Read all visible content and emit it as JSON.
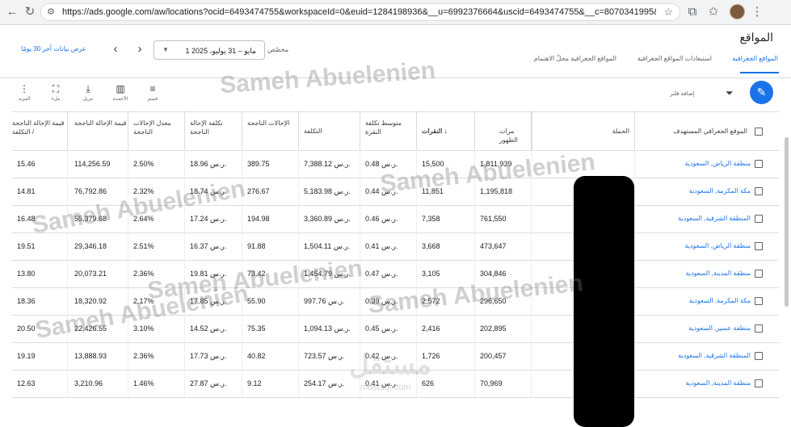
{
  "browser": {
    "url": "https://ads.google.com/aw/locations?ocid=6493474755&workspaceId=0&euid=1284198936&__u=6992376664&uscid=6493474755&__c=8070341995&authuser=..."
  },
  "page": {
    "title": "المواقع",
    "tabs": [
      "المواقع الجغرافية",
      "استبعادات المواقع الجغرافية",
      "المواقع الجغرافية محلّ الاهتمام"
    ],
    "date_range": "1 مايو – 31 يوليو، 2025",
    "custom_label": "مخصّص",
    "show_last_30": "عرض بيانات آخر 30 يومًا"
  },
  "toolbar": {
    "add_filter": "إضافة فلتر",
    "tools": [
      {
        "icon": "segment-icon",
        "glyph": "≡",
        "label": "قسم"
      },
      {
        "icon": "columns-icon",
        "glyph": "▥",
        "label": "الأعمدة"
      },
      {
        "icon": "download-icon",
        "glyph": "⤓",
        "label": "تنزيل"
      },
      {
        "icon": "expand-icon",
        "glyph": "⛶",
        "label": "ملء"
      },
      {
        "icon": "more-icon",
        "glyph": "⋮",
        "label": "المزيد"
      }
    ]
  },
  "table": {
    "headers": {
      "location": "الموقع الجغرافي المستهدف",
      "campaign": "الحملة",
      "impressions": "مرات الظهور",
      "clicks": "النقرات",
      "avg_cpc": "متوسط تكلفة النقرة",
      "cost": "التكلفة",
      "conversions": "الإحالات الناجحة",
      "cost_per_conv": "تكلفة الإحالة الناجحة",
      "conv_rate": "معدل الإحالات الناجحة",
      "conv_value": "قيمة الإحالة الناجحة",
      "value_per_cost": "قيمة الإحالة الناجحة / التكلفة"
    },
    "rows": [
      {
        "location": "منطقة الرياض, السعودية",
        "impressions": "1,811,939",
        "clicks": "15,500",
        "avg_cpc": "0.48 ر.س.",
        "cost": "7,388.12 ر.س.",
        "conversions": "389.75",
        "cost_per_conv": "18.96 ر.س.",
        "conv_rate": "2.50%",
        "conv_value": "114,256.59",
        "value_per_cost": "15.46"
      },
      {
        "location": "مكة المكرمة, السعودية",
        "impressions": "1,195,818",
        "clicks": "11,851",
        "avg_cpc": "0.44 ر.س.",
        "cost": "5,183.98 ر.س.",
        "conversions": "276.67",
        "cost_per_conv": "18.74 ر.س.",
        "conv_rate": "2.32%",
        "conv_value": "76,792.86",
        "value_per_cost": "14.81"
      },
      {
        "location": "المنطقة الشرقية, السعودية",
        "impressions": "761,550",
        "clicks": "7,358",
        "avg_cpc": "0.46 ر.س.",
        "cost": "3,360.89 ر.س.",
        "conversions": "194.98",
        "cost_per_conv": "17.24 ر.س.",
        "conv_rate": "2.64%",
        "conv_value": "55,379.68",
        "value_per_cost": "16.48"
      },
      {
        "location": "منطقة الرياض, السعودية",
        "impressions": "473,647",
        "clicks": "3,668",
        "avg_cpc": "0.41 ر.س.",
        "cost": "1,504.11 ر.س.",
        "conversions": "91.88",
        "cost_per_conv": "16.37 ر.س.",
        "conv_rate": "2.51%",
        "conv_value": "29,346.18",
        "value_per_cost": "19.51"
      },
      {
        "location": "منطقة المدينة, السعودية",
        "impressions": "304,846",
        "clicks": "3,105",
        "avg_cpc": "0.47 ر.س.",
        "cost": "1,454.79 ر.س.",
        "conversions": "73.42",
        "cost_per_conv": "19.81 ر.س.",
        "conv_rate": "2.36%",
        "conv_value": "20,073.21",
        "value_per_cost": "13.80"
      },
      {
        "location": "مكة المكرمة, السعودية",
        "impressions": "296,650",
        "clicks": "2,572",
        "avg_cpc": "0.39 ر.س.",
        "cost": "997.76 ر.س.",
        "conversions": "55.90",
        "cost_per_conv": "17.85 ر.س.",
        "conv_rate": "2.17%",
        "conv_value": "18,320.92",
        "value_per_cost": "18.36"
      },
      {
        "location": "منطقة عسير, السعودية",
        "impressions": "202,895",
        "clicks": "2,416",
        "avg_cpc": "0.45 ر.س.",
        "cost": "1,094.13 ر.س.",
        "conversions": "75.35",
        "cost_per_conv": "14.52 ر.س.",
        "conv_rate": "3.10%",
        "conv_value": "22,426.55",
        "value_per_cost": "20.50"
      },
      {
        "location": "المنطقة الشرقية, السعودية",
        "impressions": "200,457",
        "clicks": "1,726",
        "avg_cpc": "0.42 ر.س.",
        "cost": "723.57 ر.س.",
        "conversions": "40.82",
        "cost_per_conv": "17.73 ر.س.",
        "conv_rate": "2.36%",
        "conv_value": "13,888.93",
        "value_per_cost": "19.19"
      },
      {
        "location": "منطقة المدينة, السعودية",
        "impressions": "70,969",
        "clicks": "626",
        "avg_cpc": "0.41 ر.س.",
        "cost": "254.17 ر.س.",
        "conversions": "9.12",
        "cost_per_conv": "27.87 ر.س.",
        "conv_rate": "1.46%",
        "conv_value": "3,210.96",
        "value_per_cost": "12.63"
      }
    ]
  },
  "watermarks": [
    "Sameh Abuelenien",
    "مستقل",
    "mostaql.com"
  ]
}
